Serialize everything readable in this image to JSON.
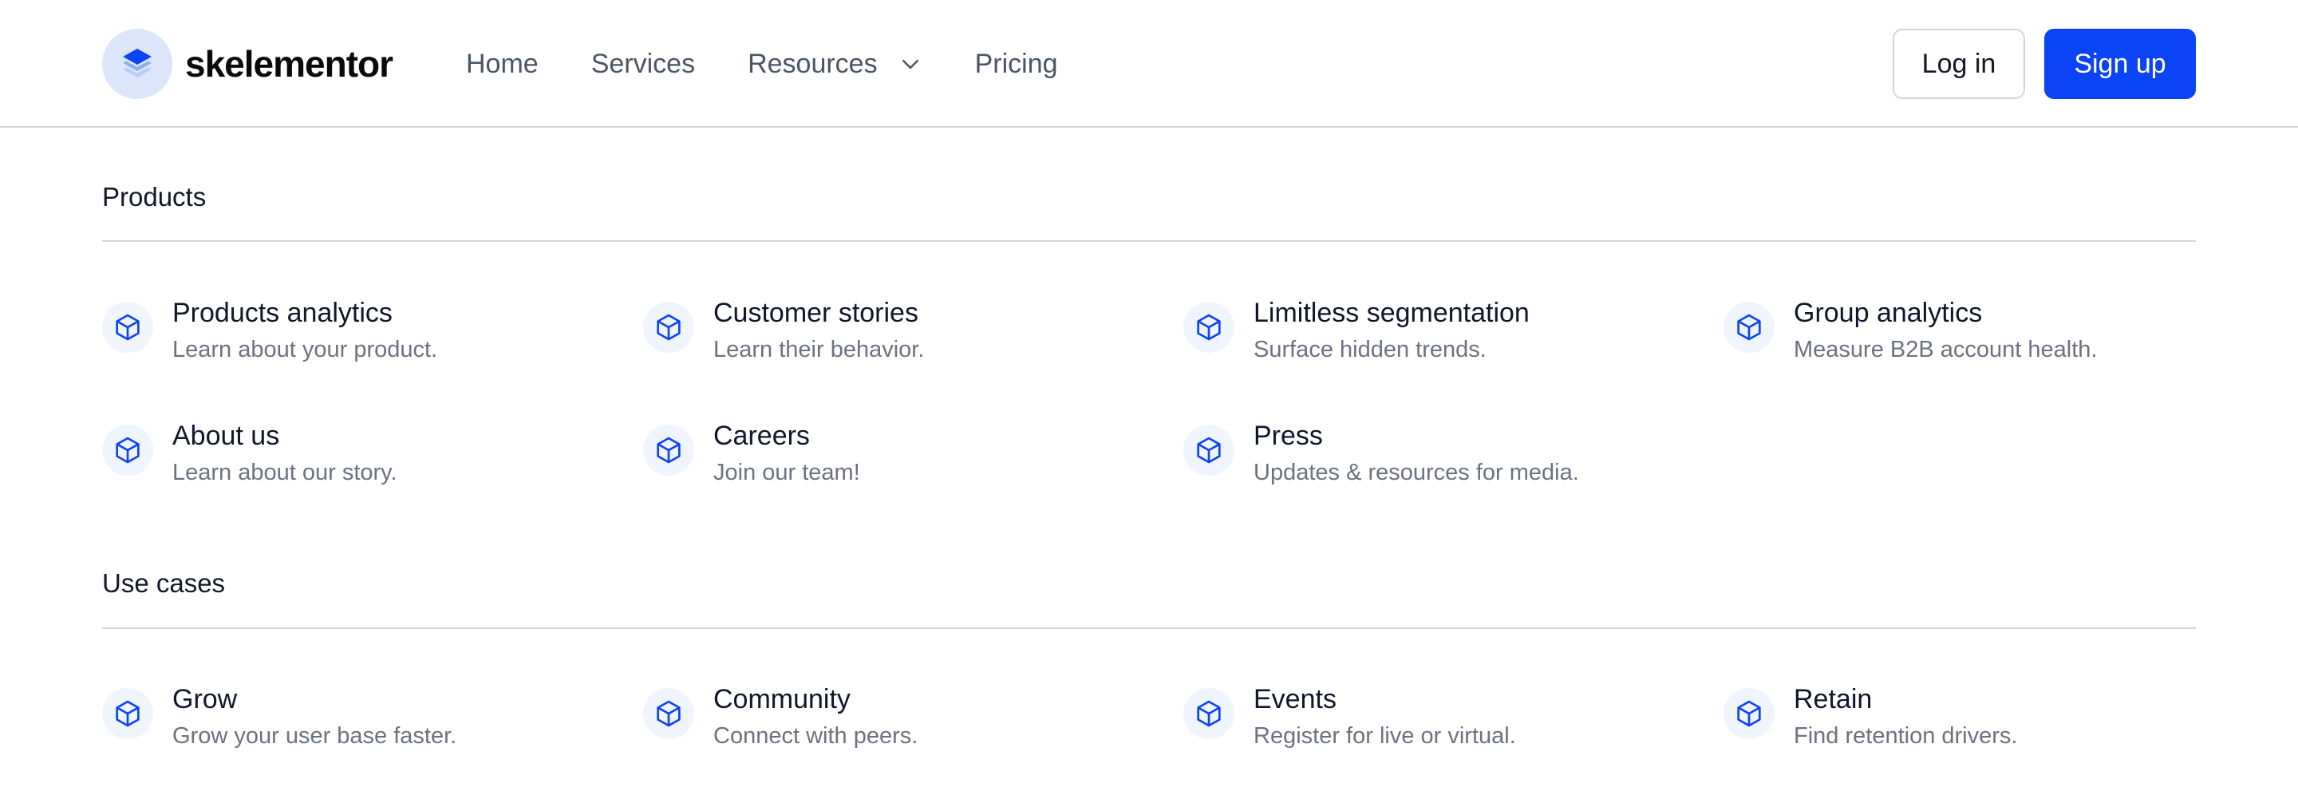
{
  "brand": {
    "name": "skelementor",
    "logo_icon": "stack-layers-icon",
    "accent": "#0b43f6"
  },
  "nav": {
    "items": [
      {
        "label": "Home"
      },
      {
        "label": "Services"
      },
      {
        "label": "Resources",
        "icon": "chevron-down-icon"
      },
      {
        "label": "Pricing"
      }
    ]
  },
  "auth": {
    "login_label": "Log in",
    "signup_label": "Sign up"
  },
  "sections": [
    {
      "title": "Products",
      "items": [
        {
          "title": "Products analytics",
          "desc": "Learn about your product.",
          "icon": "cube-icon"
        },
        {
          "title": "Customer stories",
          "desc": "Learn their behavior.",
          "icon": "cube-icon"
        },
        {
          "title": "Limitless segmentation",
          "desc": "Surface hidden trends.",
          "icon": "cube-icon"
        },
        {
          "title": "Group analytics",
          "desc": "Measure B2B account health.",
          "icon": "cube-icon"
        },
        {
          "title": "About us",
          "desc": "Learn about our story.",
          "icon": "cube-icon"
        },
        {
          "title": "Careers",
          "desc": "Join our team!",
          "icon": "cube-icon"
        },
        {
          "title": "Press",
          "desc": "Updates & resources for media.",
          "icon": "cube-icon"
        }
      ]
    },
    {
      "title": "Use cases",
      "items": [
        {
          "title": "Grow",
          "desc": "Grow your user base faster.",
          "icon": "cube-icon"
        },
        {
          "title": "Community",
          "desc": "Connect with peers.",
          "icon": "cube-icon"
        },
        {
          "title": "Events",
          "desc": "Register for live or virtual.",
          "icon": "cube-icon"
        },
        {
          "title": "Retain",
          "desc": "Find retention drivers.",
          "icon": "cube-icon"
        }
      ]
    }
  ]
}
